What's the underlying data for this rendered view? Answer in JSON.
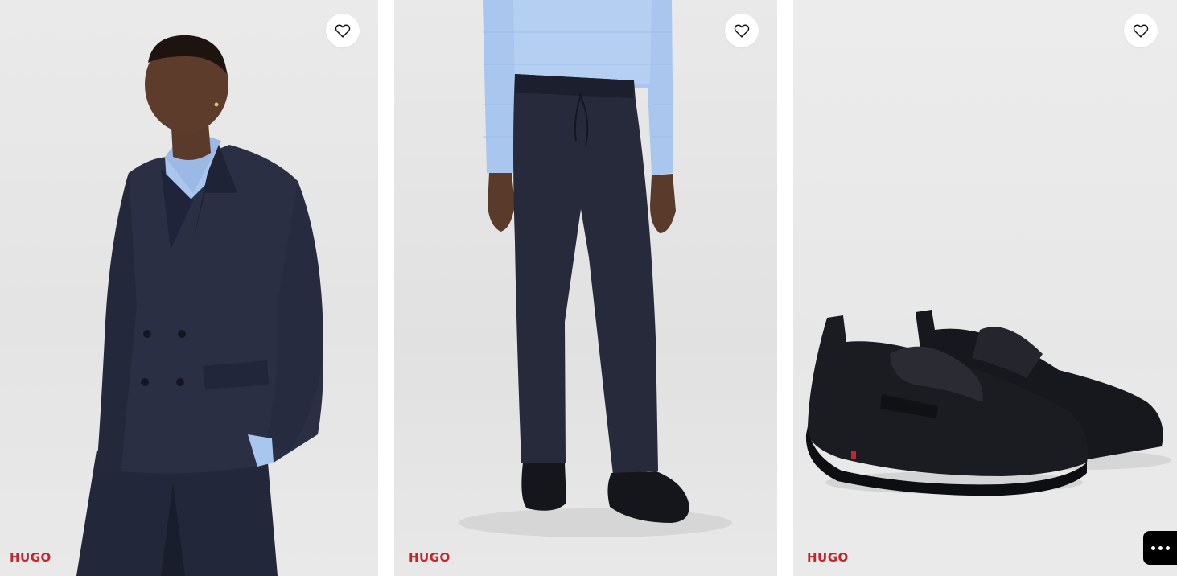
{
  "products": [
    {
      "brand": "HUGO",
      "image": "man-in-navy-double-breasted-suit",
      "wishlist_icon": "heart-outline-icon"
    },
    {
      "brand": "HUGO",
      "image": "navy-drawstring-trousers-with-loafers",
      "wishlist_icon": "heart-outline-icon"
    },
    {
      "brand": "HUGO",
      "image": "black-leather-penny-loafers",
      "wishlist_icon": "heart-outline-icon"
    }
  ],
  "more_button_icon": "ellipsis-icon",
  "colors": {
    "brand_red": "#c0262d",
    "navy": "#262a3a",
    "shirt_blue": "#a9c6ee",
    "background": "#e6e6e6"
  }
}
